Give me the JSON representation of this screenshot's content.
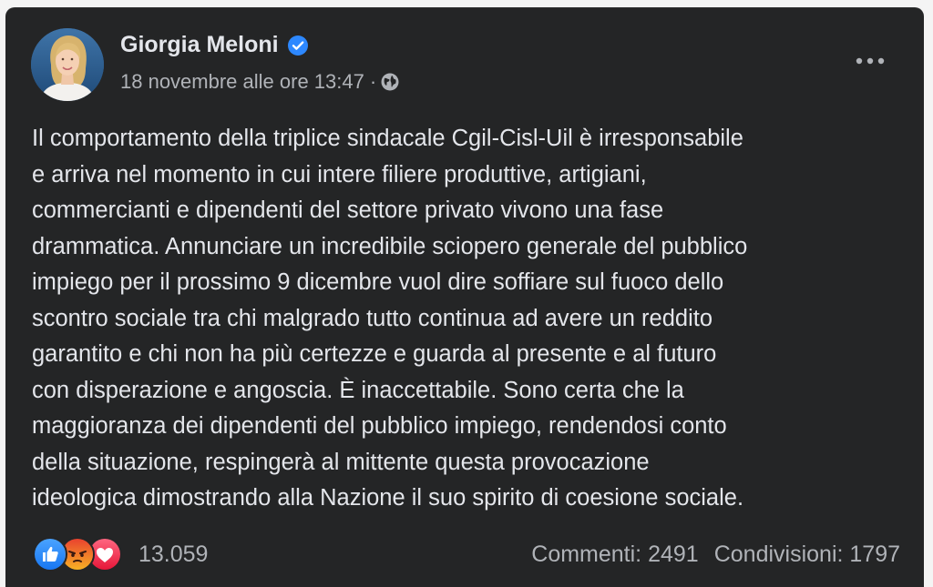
{
  "author": {
    "name": "Giorgia Meloni",
    "verified": true
  },
  "meta": {
    "timestamp": "18 novembre alle ore 13:47",
    "separator": "·",
    "audience_icon": "globe-icon"
  },
  "post": {
    "lines": [
      "Il comportamento della triplice sindacale Cgil-Cisl-Uil è irresponsabile",
      "e arriva nel momento in cui intere filiere produttive, artigiani,",
      "commercianti e dipendenti del settore privato vivono una fase",
      "drammatica. Annunciare un incredibile sciopero generale del pubblico",
      "impiego per il prossimo 9 dicembre vuol dire soffiare sul fuoco dello",
      "scontro sociale tra chi malgrado tutto continua ad avere un reddito",
      "garantito e chi non ha più certezze e guarda al presente e al futuro",
      "con disperazione e angoscia. È inaccettabile. Sono certa che la",
      "maggioranza dei dipendenti del pubblico impiego, rendendosi conto",
      "della situazione, respingerà al mittente questa provocazione",
      "ideologica dimostrando alla Nazione il suo spirito di coesione sociale."
    ]
  },
  "footer": {
    "reaction_icons": [
      "like-icon",
      "angry-icon",
      "love-icon"
    ],
    "reaction_count": "13.059",
    "comments": "Commenti: 2491",
    "shares": "Condivisioni: 1797"
  },
  "colors": {
    "card_background": "#242526",
    "primary_text": "#e4e6eb",
    "secondary_text": "#b0b3b8",
    "verified_blue": "#2d88ff",
    "like_blue": "#1877f2",
    "love_red": "#f33e58",
    "angry_orange": "#e9710f"
  }
}
